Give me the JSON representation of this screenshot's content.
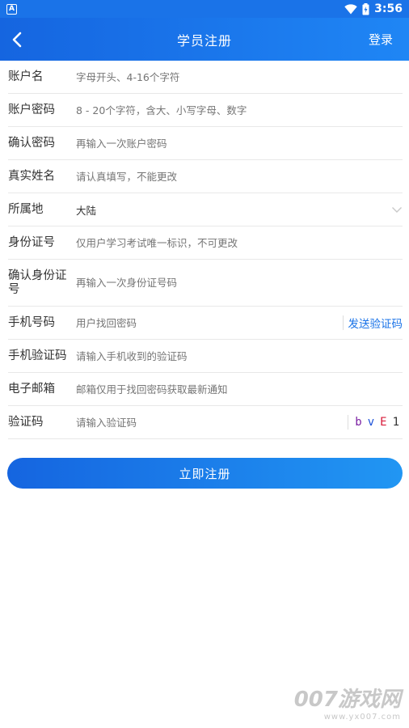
{
  "status_bar": {
    "notification_glyph": "A",
    "time": "3:56"
  },
  "header": {
    "title": "学员注册",
    "login_label": "登录"
  },
  "form": {
    "rows": [
      {
        "label": "账户名",
        "placeholder": "字母开头、4-16个字符"
      },
      {
        "label": "账户密码",
        "placeholder": "8 - 20个字符，含大、小写字母、数字"
      },
      {
        "label": "确认密码",
        "placeholder": "再输入一次账户密码"
      },
      {
        "label": "真实姓名",
        "placeholder": "请认真填写，不能更改"
      },
      {
        "label": "所属地",
        "value": "大陆"
      },
      {
        "label": "身份证号",
        "placeholder": "仅用户学习考试唯一标识，不可更改"
      },
      {
        "label": "确认身份证号",
        "placeholder": "再输入一次身份证号码"
      },
      {
        "label": "手机号码",
        "placeholder": "用户找回密码",
        "action": "发送验证码"
      },
      {
        "label": "手机验证码",
        "placeholder": "请输入手机收到的验证码"
      },
      {
        "label": "电子邮箱",
        "placeholder": "邮箱仅用于找回密码获取最新通知"
      },
      {
        "label": "验证码",
        "placeholder": "请输入验证码"
      }
    ],
    "captcha": {
      "chars": [
        "b",
        "v",
        "E",
        "1"
      ],
      "colors": [
        "#7a1fa2",
        "#1a4fd8",
        "#d81b3a",
        "#333333"
      ]
    }
  },
  "submit_label": "立即注册",
  "watermark": {
    "main": "007游戏网",
    "url": "www.yx007.com"
  },
  "colors": {
    "primary": "#1a73e8",
    "divider": "#e8e8e8"
  }
}
